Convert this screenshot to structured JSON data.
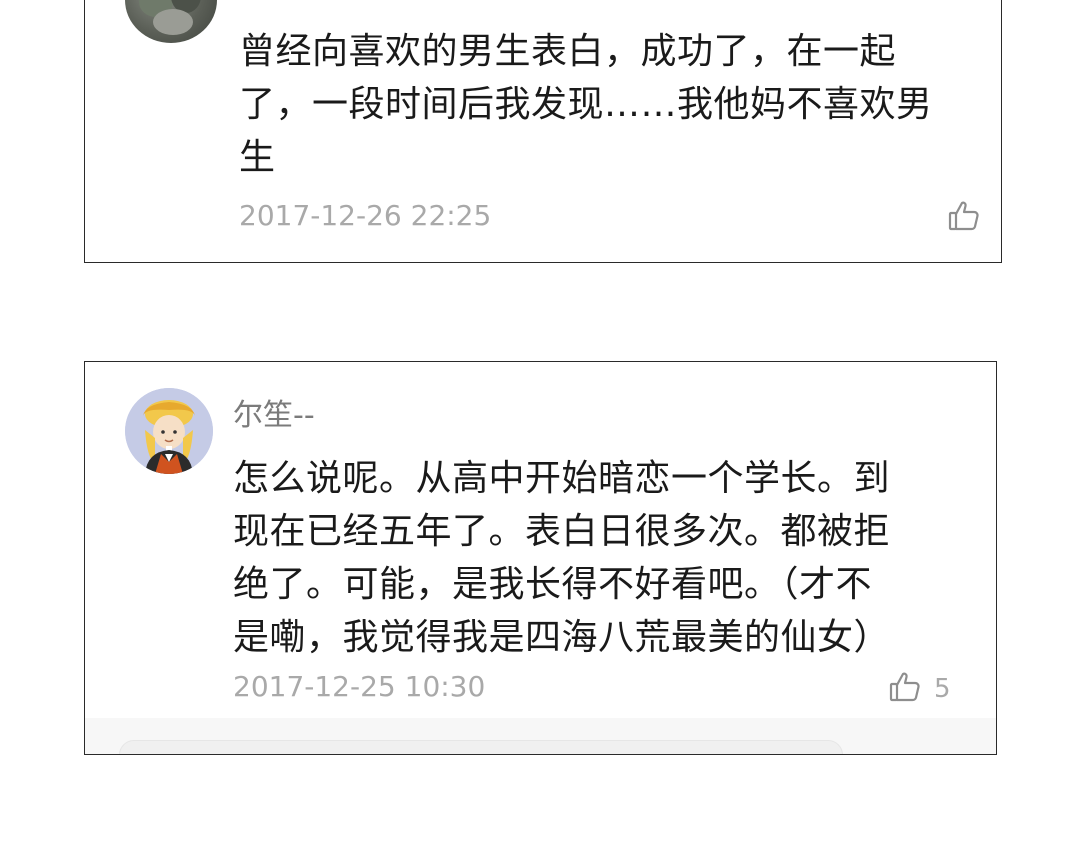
{
  "comments": [
    {
      "username": "",
      "text_lines": [
        "曾经向喜欢的男生表白，成功了，在一起",
        "了，一段时间后我发现……我他妈不喜欢男",
        "生"
      ],
      "time": "2017-12-26 22:25",
      "like_count": "",
      "like_icon": "thumbs-up-icon"
    },
    {
      "username": "尔笙--",
      "text_lines": [
        "怎么说呢。从高中开始暗恋一个学长。到",
        "现在已经五年了。表白日很多次。都被拒",
        "绝了。可能，是我长得不好看吧。（才不",
        "是嘞，我觉得我是四海八荒最美的仙女）"
      ],
      "time": "2017-12-25 10:30",
      "like_count": "5",
      "like_icon": "thumbs-up-icon"
    }
  ],
  "colors": {
    "username": "#7b7b7b",
    "text": "#1a1a1a",
    "meta": "#a9a9a9",
    "card_border": "#2a2a2a"
  }
}
